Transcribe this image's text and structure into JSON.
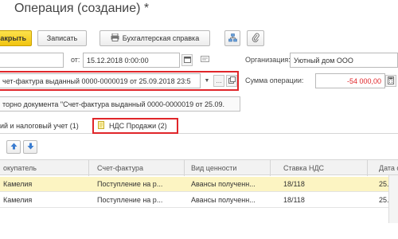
{
  "window": {
    "title": "Операция (создание) *"
  },
  "toolbar": {
    "close_label": "акрыть",
    "save_label": "Записать",
    "accounting_report_label": "Бухгалтерская справка"
  },
  "header": {
    "number_value": "",
    "date_label": "от:",
    "date_value": "15.12.2018  0:00:00",
    "organization_label": "Организация:",
    "organization_value": "Уютный дом ООО",
    "document_value": "чет-фактура выданный 0000-0000019 от 25.09.2018 23:5",
    "sum_label": "Сумма операции:",
    "sum_value": "-54 000,00",
    "reversal_label": "торно документа \"Счет-фактура выданный 0000-0000019 от 25.09."
  },
  "tabs": [
    {
      "label": "ий и налоговый учет (1)"
    },
    {
      "label": "НДС Продажи (2)"
    }
  ],
  "table": {
    "columns": [
      "окупатель",
      "Счет-фактура",
      "Вид ценности",
      "Ставка НДС",
      "Дата о"
    ],
    "rows": [
      [
        "Камелия",
        "Поступление на р...",
        "Авансы полученн...",
        "18/118",
        "25.09."
      ],
      [
        "Камелия",
        "Поступление на р...",
        "Авансы полученн...",
        "18/118",
        "25.09."
      ]
    ]
  },
  "colors": {
    "primary_button": "#f1c40f",
    "highlight_border": "#e0262a",
    "selected_row": "#fcf4c2",
    "sum_text": "#e0262a",
    "arrow_blue": "#3a7cd0"
  }
}
